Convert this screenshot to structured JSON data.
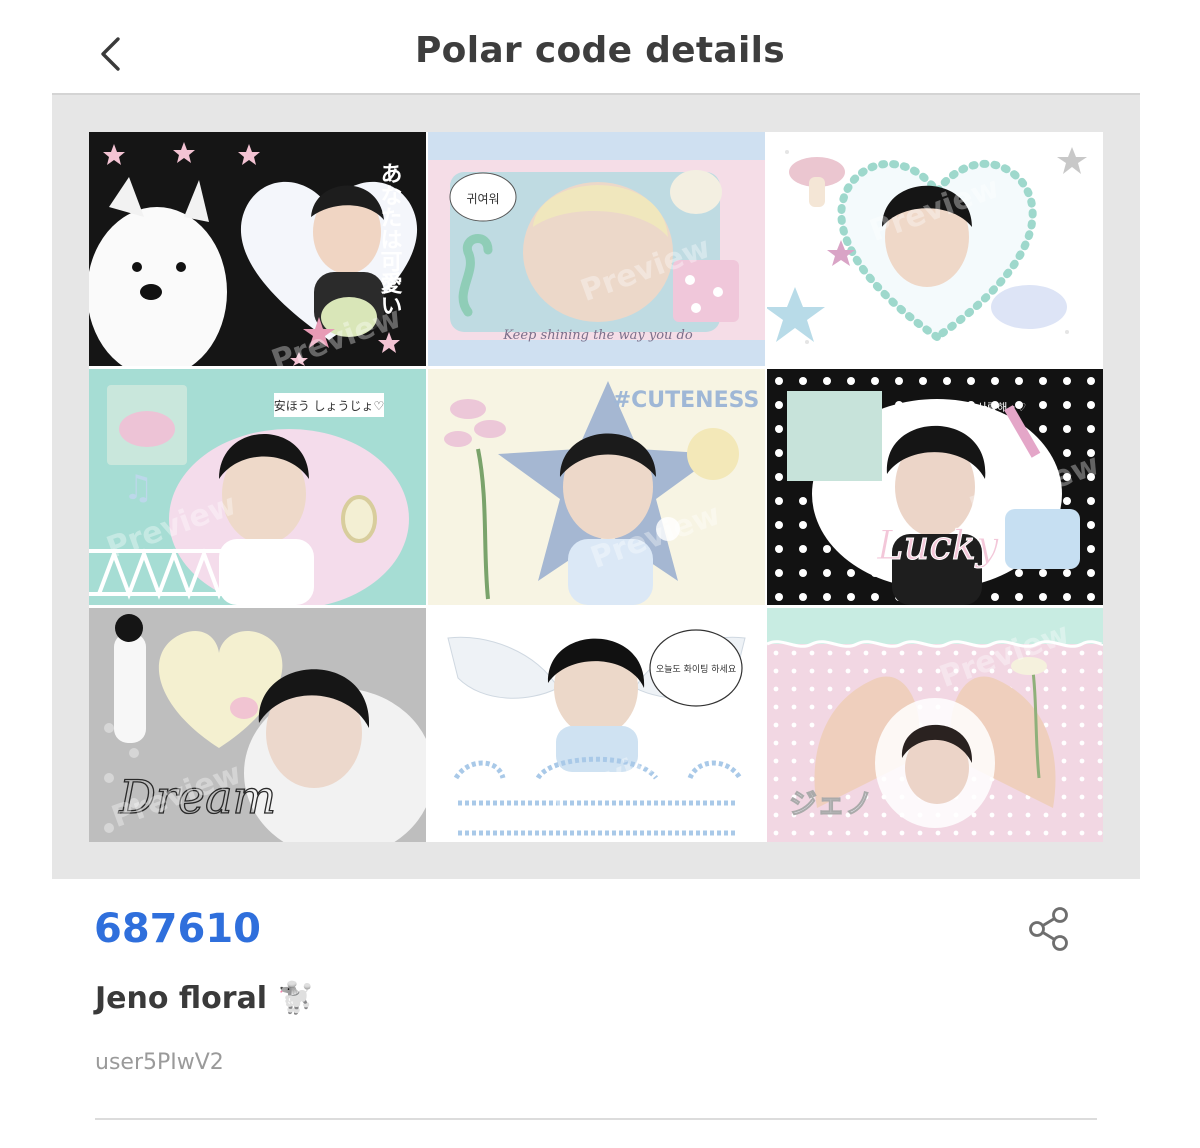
{
  "header": {
    "title": "Polar code details",
    "back_icon": "chevron-left-icon"
  },
  "preview": {
    "watermark": "Preview",
    "tiles": [
      {
        "name": "samoyed-heart",
        "palette": [
          "#141414",
          "#f6f6f6",
          "#f3c3d3"
        ],
        "caption": "あなたは可愛い"
      },
      {
        "name": "seahorse-shell",
        "palette": [
          "#d9e6f3",
          "#f6dbe6",
          "#bcd8e3"
        ],
        "caption": "Keep shining the way you do",
        "bubble": "귀여워"
      },
      {
        "name": "pearl-heart",
        "palette": [
          "#ffffff",
          "#9ed8cc",
          "#c8e3ee"
        ]
      },
      {
        "name": "lotus-mirror",
        "palette": [
          "#a7ded6",
          "#f4dbe9",
          "#ffffff"
        ],
        "bubble": "安ほう しょうじょ♡"
      },
      {
        "name": "lily-star",
        "palette": [
          "#f7f4e3",
          "#dfe8f3",
          "#9fb2cf"
        ],
        "caption": "#CUTENESS"
      },
      {
        "name": "lucky-dots",
        "palette": [
          "#121212",
          "#ffffff",
          "#e9c2d6"
        ],
        "caption": "Lucky",
        "bubble": "사랑해 ･♡"
      },
      {
        "name": "dream-heart",
        "palette": [
          "#bfbfbf",
          "#f2f2f2",
          "#f5f1d6"
        ],
        "caption": "Dream"
      },
      {
        "name": "angel-wings",
        "palette": [
          "#ffffff",
          "#c8def0",
          "#eef4fa"
        ],
        "bubble": "오늘도 화이팅 하세요"
      },
      {
        "name": "jeno-hands",
        "palette": [
          "#f2d6e2",
          "#c9ece3",
          "#ffffff"
        ],
        "caption": "ジェノ"
      }
    ]
  },
  "details": {
    "code": "687610",
    "name": "Jeno floral",
    "emoji": "🐩",
    "user": "user5PIwV2",
    "share_icon": "share-icon"
  }
}
